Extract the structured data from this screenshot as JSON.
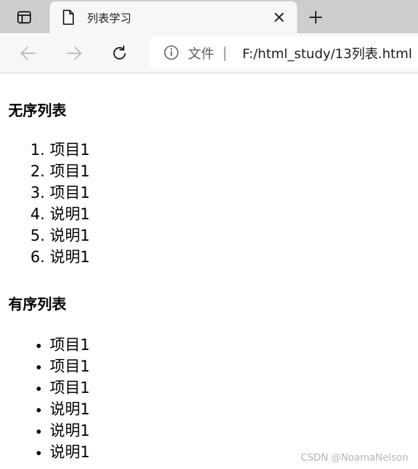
{
  "browser": {
    "tab": {
      "title": "列表学习"
    },
    "address": {
      "scheme": "文件",
      "separator": "|",
      "url": "F:/html_study/13列表.html"
    }
  },
  "page": {
    "unordered_heading": "无序列表",
    "ordered_items": [
      "项目1",
      "项目1",
      "项目1",
      "说明1",
      "说明1",
      "说明1"
    ],
    "ordered_heading": "有序列表",
    "bullet_items": [
      "项目1",
      "项目1",
      "项目1",
      "说明1",
      "说明1",
      "说明1"
    ]
  },
  "watermark": "CSDN @NoamaNelson",
  "icons": {
    "tab_actions": "tab-actions-icon",
    "page": "page-icon",
    "close": "close-icon",
    "new_tab": "plus-icon",
    "back": "back-arrow-icon",
    "forward": "forward-arrow-icon",
    "refresh": "refresh-icon",
    "info": "info-icon"
  }
}
